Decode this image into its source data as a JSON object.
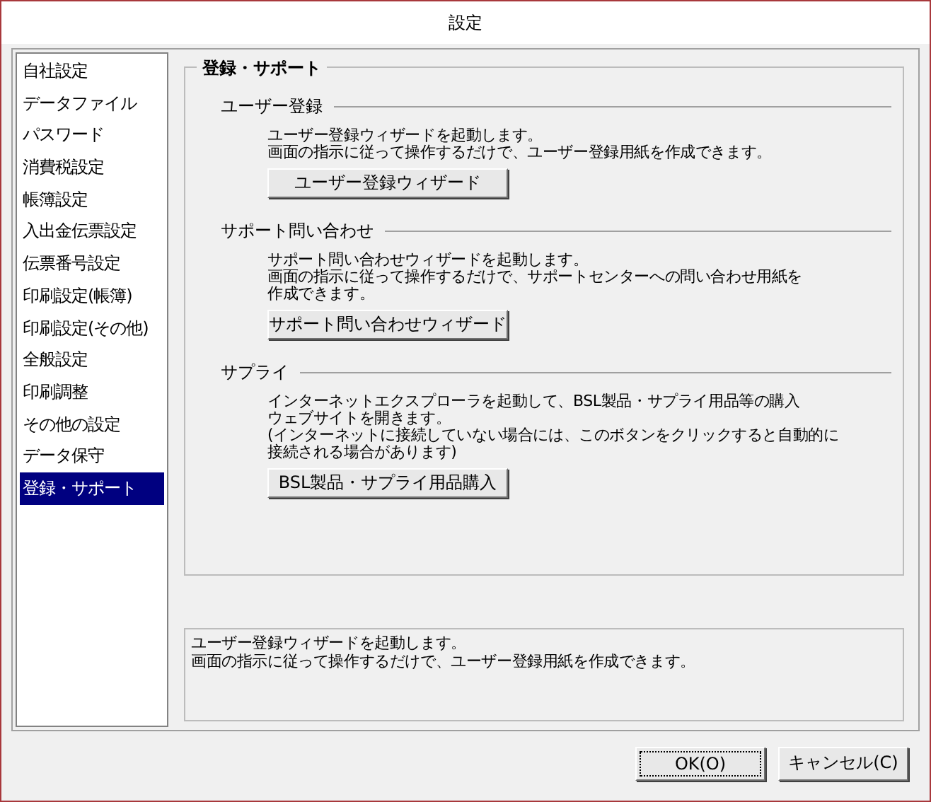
{
  "window": {
    "title": "設定"
  },
  "sidebar": {
    "items": [
      {
        "label": "自社設定",
        "selected": false
      },
      {
        "label": "データファイル",
        "selected": false
      },
      {
        "label": "パスワード",
        "selected": false
      },
      {
        "label": "消費税設定",
        "selected": false
      },
      {
        "label": "帳簿設定",
        "selected": false
      },
      {
        "label": "入出金伝票設定",
        "selected": false
      },
      {
        "label": "伝票番号設定",
        "selected": false
      },
      {
        "label": "印刷設定(帳簿)",
        "selected": false
      },
      {
        "label": "印刷設定(その他)",
        "selected": false
      },
      {
        "label": "全般設定",
        "selected": false
      },
      {
        "label": "印刷調整",
        "selected": false
      },
      {
        "label": "その他の設定",
        "selected": false
      },
      {
        "label": "データ保守",
        "selected": false
      },
      {
        "label": "登録・サポート",
        "selected": true
      }
    ]
  },
  "panel": {
    "title": "登録・サポート",
    "sections": [
      {
        "heading": "ユーザー登録",
        "lines": [
          "ユーザー登録ウィザードを起動します。",
          "画面の指示に従って操作するだけで、ユーザー登録用紙を作成できます。"
        ],
        "button": "ユーザー登録ウィザード"
      },
      {
        "heading": "サポート問い合わせ",
        "lines": [
          "サポート問い合わせウィザードを起動します。",
          "画面の指示に従って操作するだけで、サポートセンターへの問い合わせ用紙を",
          "作成できます。"
        ],
        "button": "サポート問い合わせウィザード"
      },
      {
        "heading": "サプライ",
        "lines": [
          "インターネットエクスプローラを起動して、BSL製品・サプライ用品等の購入",
          "ウェブサイトを開きます。",
          "(インターネットに接続していない場合には、このボタンをクリックすると自動的に",
          "接続される場合があります)"
        ],
        "button": "BSL製品・サプライ用品購入"
      }
    ]
  },
  "help_lines": [
    "ユーザー登録ウィザードを起動します。",
    "画面の指示に従って操作するだけで、ユーザー登録用紙を作成できます。"
  ],
  "buttons": [
    {
      "label": "OK(O)",
      "default": true
    },
    {
      "label": "キャンセル(C)",
      "default": false
    }
  ]
}
